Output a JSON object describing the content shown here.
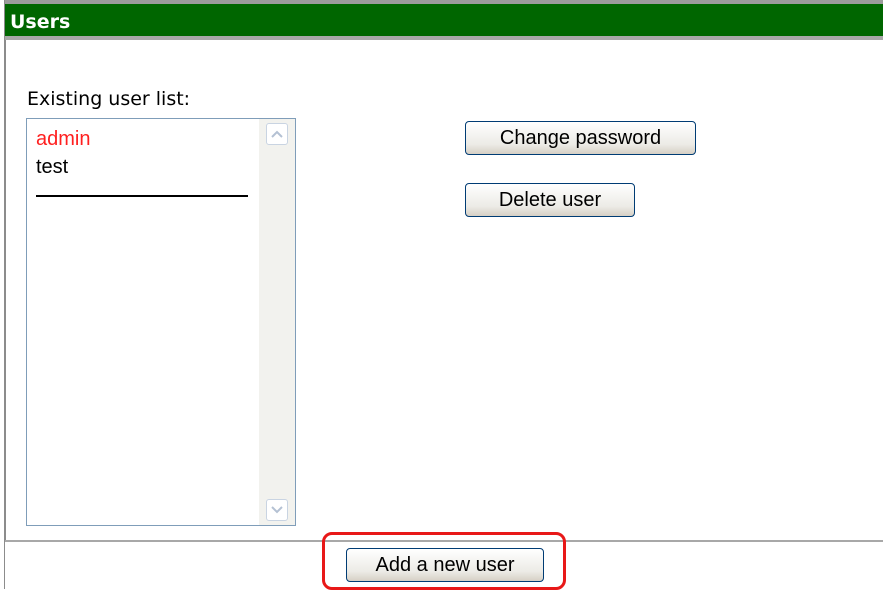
{
  "panel": {
    "title": "Users"
  },
  "user_list": {
    "label": "Existing user list:",
    "items": [
      {
        "name": "admin",
        "selected": true
      },
      {
        "name": "test",
        "selected": false
      }
    ]
  },
  "actions": {
    "change_password_label": "Change password",
    "delete_user_label": "Delete user",
    "add_user_label": "Add a new user"
  },
  "colors": {
    "title_bar": "#006600",
    "selected_item": "#ff2020",
    "highlight": "#e81818"
  },
  "icons": {
    "scroll_up": "chevron-up-icon",
    "scroll_down": "chevron-down-icon"
  }
}
